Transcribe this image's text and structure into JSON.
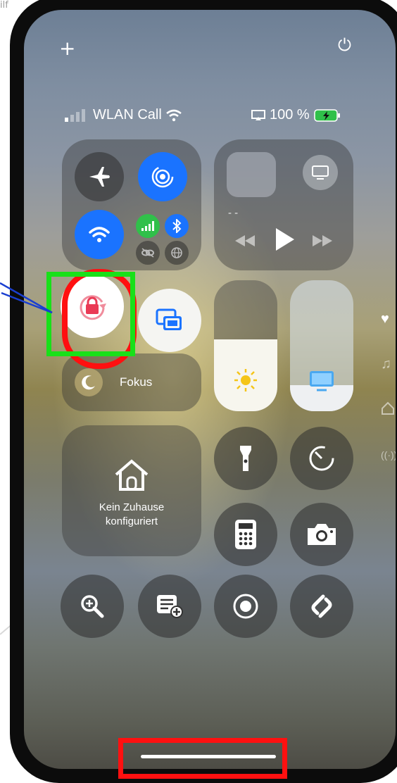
{
  "corner_text": "ilf",
  "colors": {
    "accent_blue": "#1a73ff",
    "cellular_green": "#30c04a",
    "highlight_red": "#ff1010",
    "highlight_green": "#19e019",
    "annotation_blue": "#1a3fd0"
  },
  "top_bar": {
    "add_icon": "+",
    "power_icon": "⏻"
  },
  "status_bar": {
    "carrier": "WLAN Call",
    "battery": "100 %"
  },
  "connectivity": {
    "airplane": "airplane-icon",
    "airdrop": "airdrop-icon",
    "wifi": "wifi-icon",
    "cellular": "cellular-icon",
    "bluetooth": "bluetooth-icon",
    "vpn": "link-icon",
    "hotspot": "globe-icon"
  },
  "media": {
    "now_playing": "- -",
    "airplay": "screen-mirror-icon"
  },
  "rotation_lock": {
    "icon": "rotation-lock-icon"
  },
  "screen_mirroring": {
    "icon": "screen-mirroring-icon"
  },
  "focus": {
    "label": "Fokus"
  },
  "brightness": {
    "level": 0.55
  },
  "volume": {
    "level": 0.2
  },
  "side_icons": [
    "heart-icon",
    "music-icon",
    "home-icon",
    "antenna-icon"
  ],
  "home_tile": {
    "line1": "Kein Zuhause",
    "line2": "konfiguriert"
  },
  "shortcuts": [
    "flashlight-icon",
    "timer-icon",
    "calculator-icon",
    "camera-icon",
    "magnifier-icon",
    "quick-note-icon",
    "screen-record-icon",
    "shazam-icon"
  ]
}
